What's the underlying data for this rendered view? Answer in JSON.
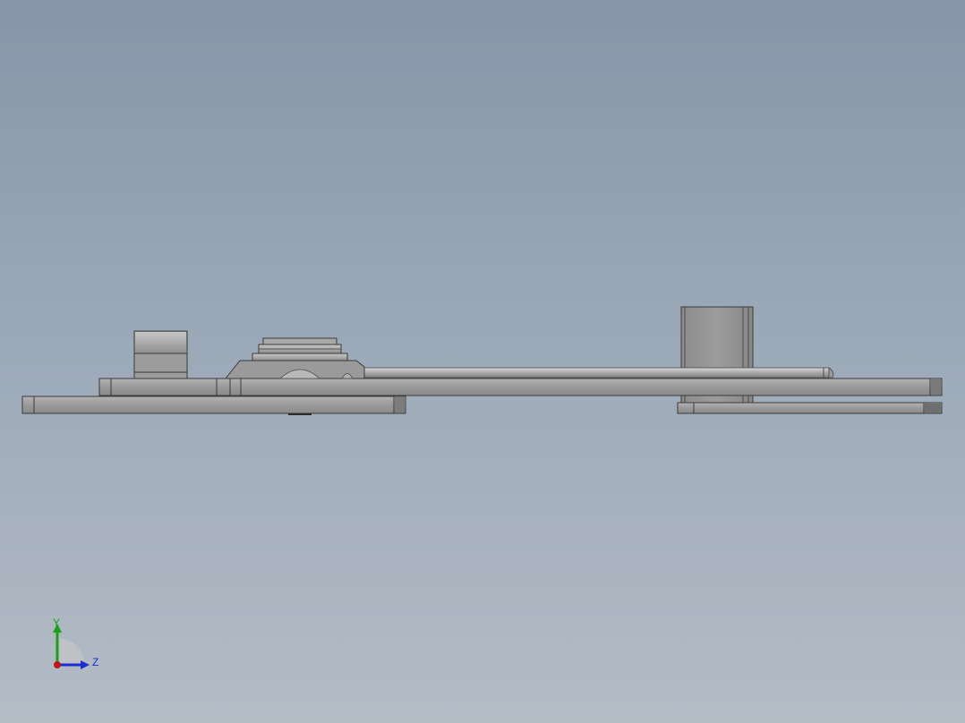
{
  "viewport": {
    "background_top": "#8795a8",
    "background_bottom": "#b4bcc6",
    "part_fill": "#9b9b9b",
    "part_edge": "#3a3a3a"
  },
  "triad": {
    "y_label": "Y",
    "z_label": "Z",
    "y_color": "#1aa01a",
    "z_color": "#1a2fd0",
    "x_color": "#c01818"
  }
}
